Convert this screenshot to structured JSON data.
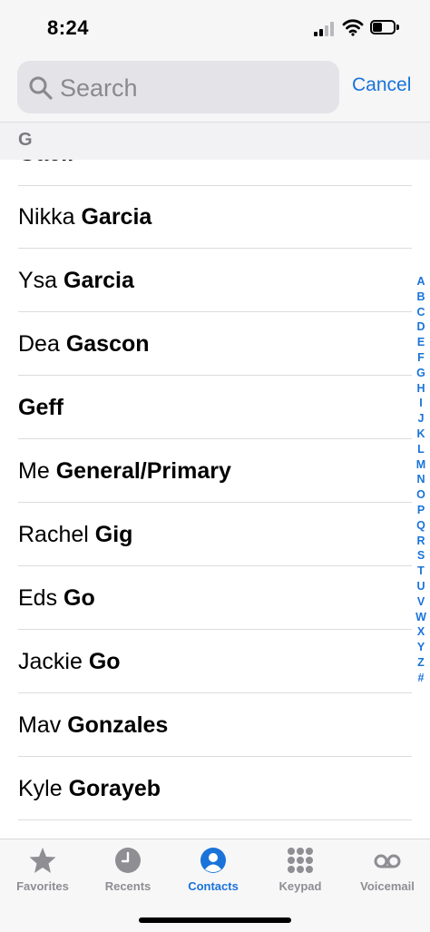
{
  "status_bar": {
    "time": "8:24"
  },
  "search": {
    "placeholder": "Search",
    "cancel_label": "Cancel"
  },
  "section": {
    "letter": "G",
    "cut_off_name": "Gaeil"
  },
  "contacts": [
    {
      "first": "Nikka ",
      "last": "Garcia"
    },
    {
      "first": "Ysa ",
      "last": "Garcia"
    },
    {
      "first": "Dea ",
      "last": "Gascon"
    },
    {
      "first": "",
      "last": "Geff"
    },
    {
      "first": "Me ",
      "last": "General/Primary"
    },
    {
      "first": "Rachel ",
      "last": "Gig"
    },
    {
      "first": "Eds ",
      "last": "Go"
    },
    {
      "first": "Jackie ",
      "last": "Go"
    },
    {
      "first": "Mav ",
      "last": "Gonzales"
    },
    {
      "first": "Kyle ",
      "last": "Gorayeb"
    }
  ],
  "index_letters": [
    "A",
    "B",
    "C",
    "D",
    "E",
    "F",
    "G",
    "H",
    "I",
    "J",
    "K",
    "L",
    "M",
    "N",
    "O",
    "P",
    "Q",
    "R",
    "S",
    "T",
    "U",
    "V",
    "W",
    "X",
    "Y",
    "Z",
    "#"
  ],
  "tab_bar": {
    "tabs": [
      {
        "label": "Favorites",
        "icon": "star-icon"
      },
      {
        "label": "Recents",
        "icon": "clock-icon"
      },
      {
        "label": "Contacts",
        "icon": "person-circle-icon"
      },
      {
        "label": "Keypad",
        "icon": "keypad-icon"
      },
      {
        "label": "Voicemail",
        "icon": "voicemail-icon"
      }
    ],
    "active": "Contacts"
  },
  "colors": {
    "accent": "#1a73d9",
    "inactive": "#8e8e93"
  }
}
